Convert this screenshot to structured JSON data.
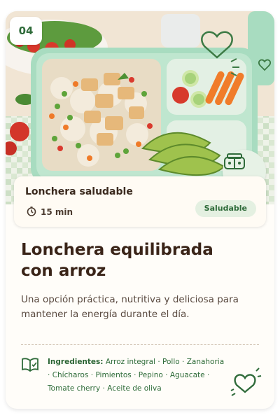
{
  "card": {
    "number": "04",
    "category_title": "Lonchera saludable",
    "time": "15 min",
    "tag": "Saludable",
    "headline_line1": "Lonchera equilibrada",
    "headline_line2": "con arroz",
    "description": "Una opción práctica, nutritiva y deliciosa para mantener la energía durante el día.",
    "ingredients_label": "Ingredientes:",
    "ingredients": [
      "Arroz integral",
      "Pollo",
      "Zanahoria",
      "Chícharos",
      "Pimientos",
      "Pepino",
      "Aguacate",
      "Tomate cherry",
      "Aceite de oliva"
    ]
  },
  "icons": {
    "clock": "clock-icon",
    "lunchbox": "lunchbox-icon",
    "book": "open-book-icon",
    "hearts": "heart-icon"
  },
  "colors": {
    "brand_green": "#2f6b3a",
    "tag_bg": "#e4f0e1",
    "headline": "#3a2418",
    "container": "#a8dcc0"
  }
}
